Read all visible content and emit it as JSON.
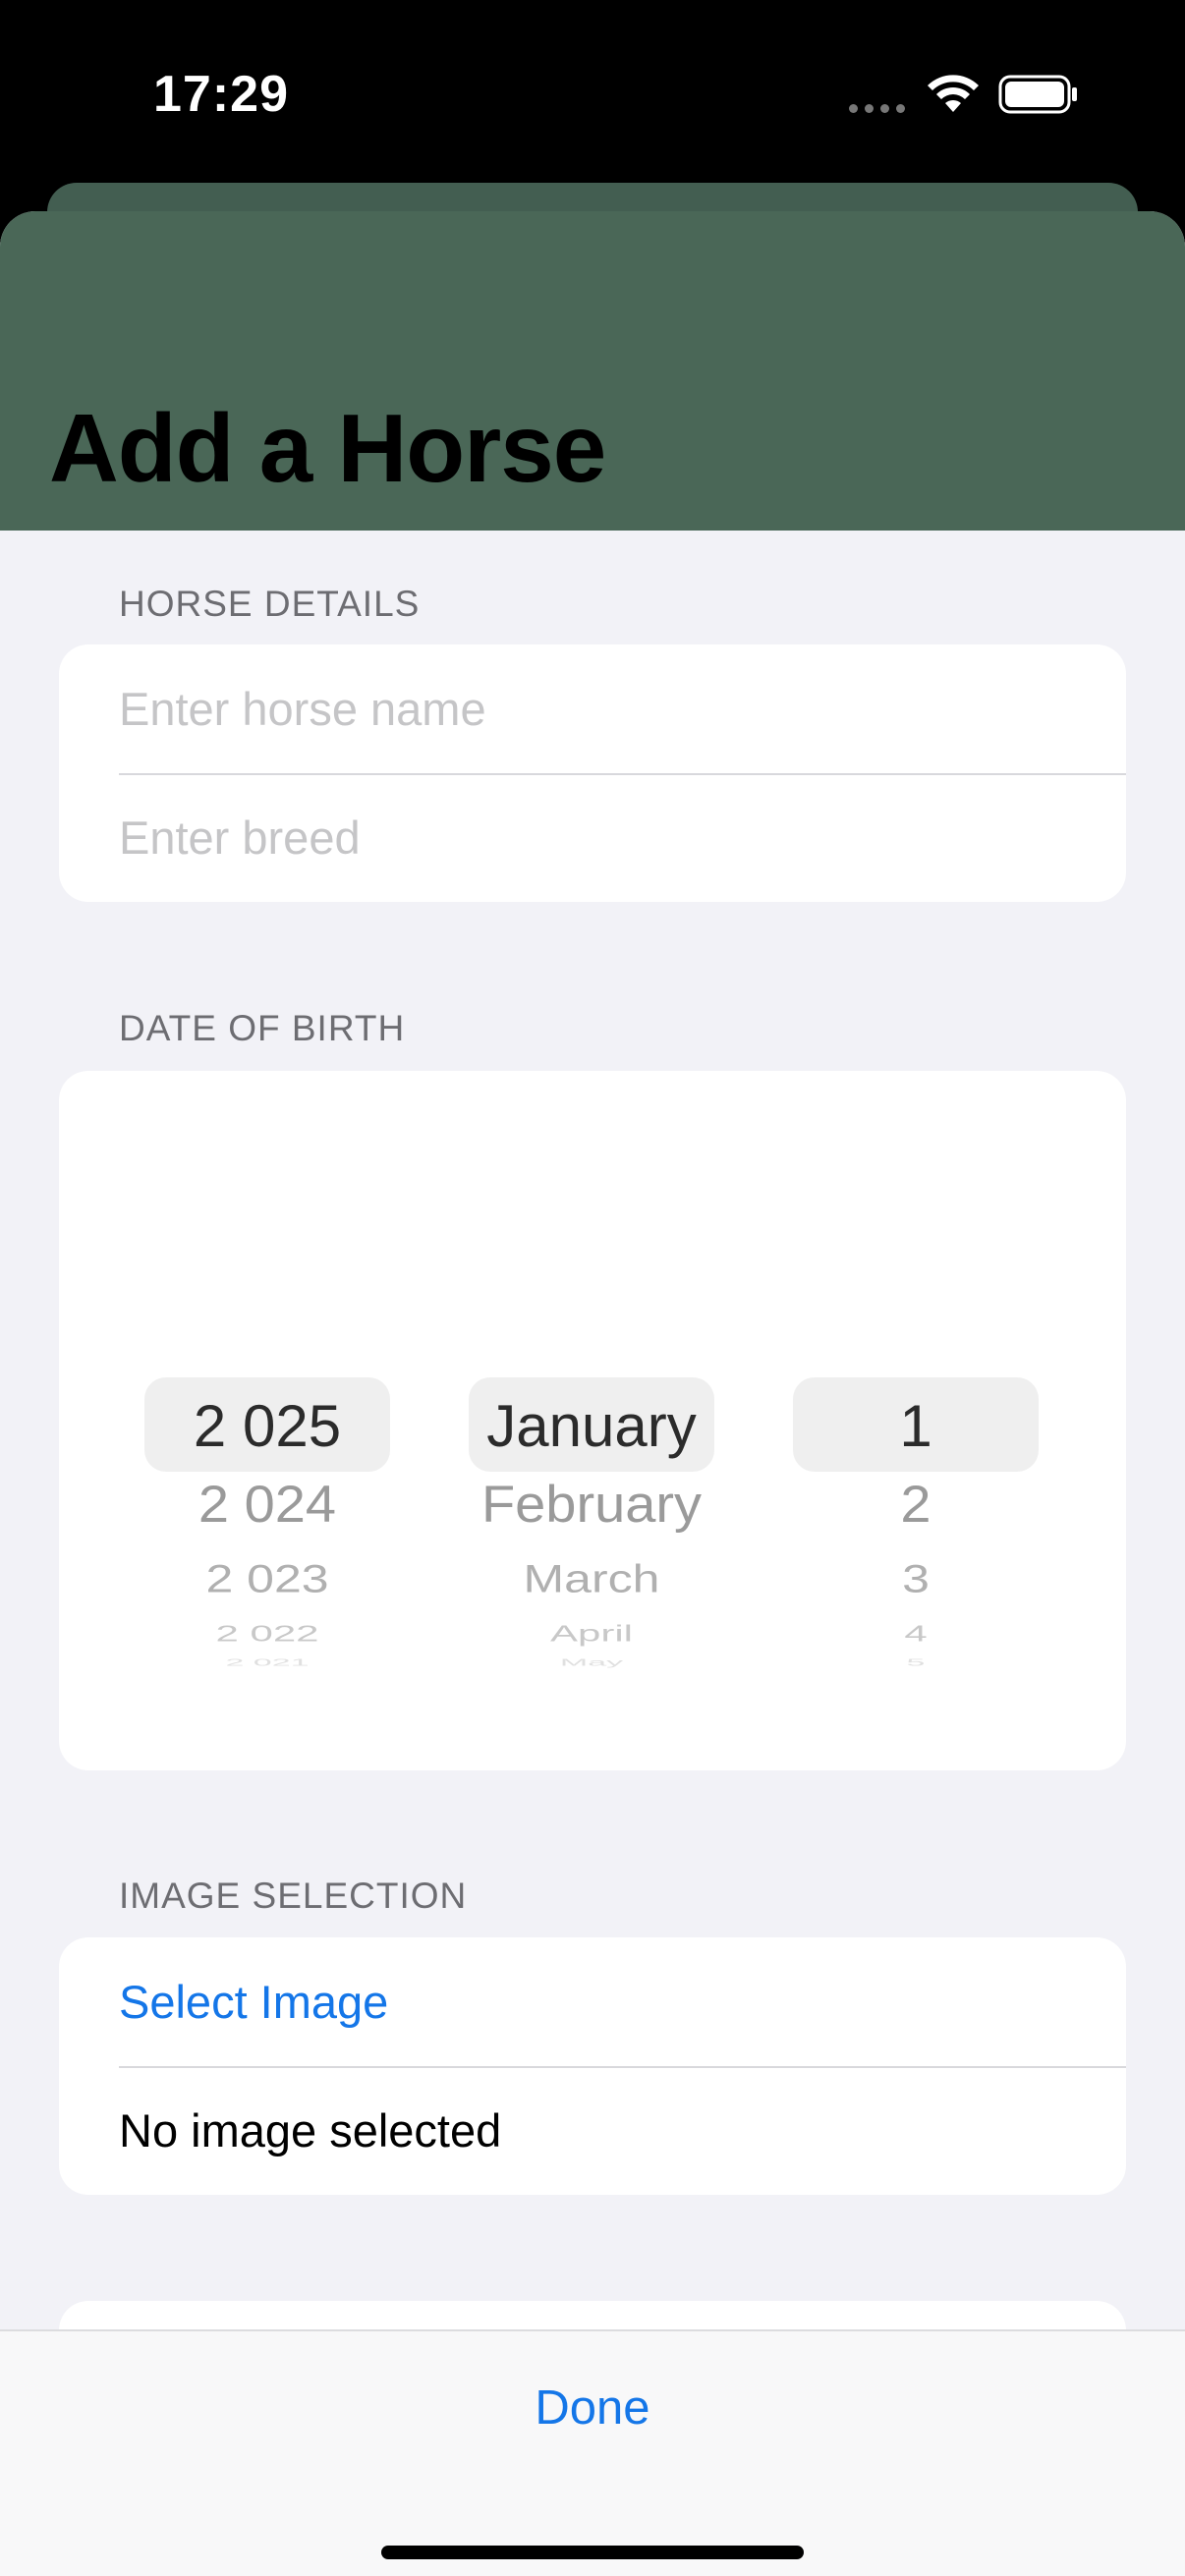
{
  "status_bar": {
    "time": "17:29"
  },
  "header": {
    "title": "Add a Horse"
  },
  "horse_details": {
    "header": "HORSE DETAILS",
    "name_placeholder": "Enter horse name",
    "breed_placeholder": "Enter breed"
  },
  "date_of_birth": {
    "header": "DATE OF BIRTH",
    "years": [
      "2 025",
      "2 024",
      "2 023",
      "2 022",
      "2 021"
    ],
    "months": [
      "January",
      "February",
      "March",
      "April",
      "May"
    ],
    "days": [
      "1",
      "2",
      "3",
      "4",
      "5"
    ]
  },
  "image_selection": {
    "header": "IMAGE SELECTION",
    "select_label": "Select Image",
    "status_text": "No image selected"
  },
  "toolbar": {
    "done_label": "Done"
  },
  "colors": {
    "header_green": "#4a6757",
    "accent_blue": "#1476e8",
    "grouped_background": "#f2f2f7"
  },
  "icons": [
    "wifi-icon",
    "battery-icon"
  ]
}
